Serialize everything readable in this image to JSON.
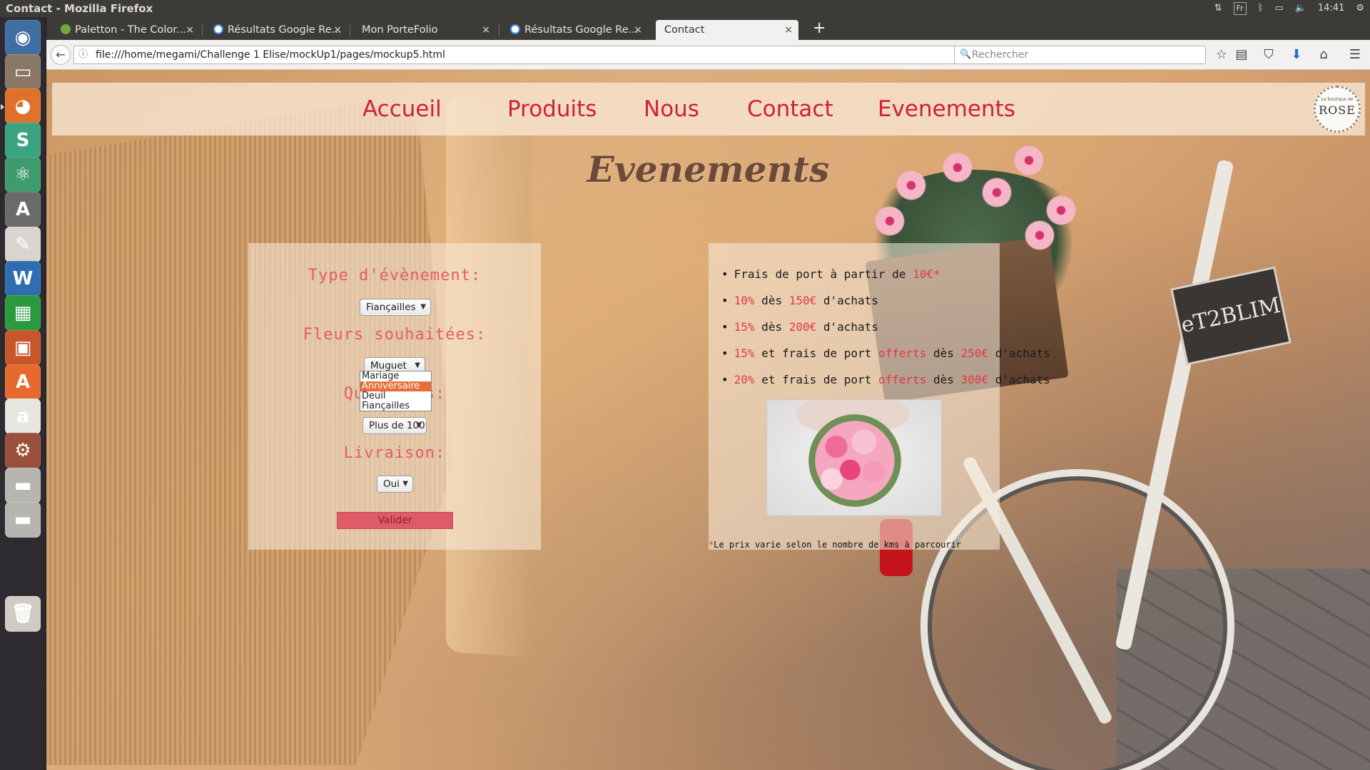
{
  "os": {
    "window_title": "Contact - Mozilla Firefox",
    "indicators": {
      "keyboard": "Fr",
      "time": "14:41"
    }
  },
  "launcher": {
    "items": [
      {
        "name": "ubuntu-dash-icon",
        "color": "#3f6ea3",
        "glyph": "◉"
      },
      {
        "name": "files-icon",
        "color": "#8a7765",
        "glyph": "▭"
      },
      {
        "name": "firefox-icon",
        "color": "#e0712a",
        "glyph": "◕"
      },
      {
        "name": "slack-icon",
        "color": "#3aa37f",
        "glyph": "S"
      },
      {
        "name": "atom-icon",
        "color": "#3e9b6e",
        "glyph": "⚛"
      },
      {
        "name": "software-updater-icon",
        "color": "#6a6a6a",
        "glyph": "A"
      },
      {
        "name": "text-editor-icon",
        "color": "#d8d5cf",
        "glyph": "✎"
      },
      {
        "name": "libreoffice-writer-icon",
        "color": "#2f6db3",
        "glyph": "W"
      },
      {
        "name": "libreoffice-calc-icon",
        "color": "#2b9a3f",
        "glyph": "▦"
      },
      {
        "name": "libreoffice-impress-icon",
        "color": "#c7562b",
        "glyph": "▣"
      },
      {
        "name": "ubuntu-software-icon",
        "color": "#e66a2c",
        "glyph": "A"
      },
      {
        "name": "amazon-icon",
        "color": "#e8e6e1",
        "glyph": "a"
      },
      {
        "name": "system-settings-icon",
        "color": "#9a4f3a",
        "glyph": "⚙"
      },
      {
        "name": "drive-icon",
        "color": "#b7b5b0",
        "glyph": "▬"
      },
      {
        "name": "drive-2-icon",
        "color": "#b7b5b0",
        "glyph": "▬"
      },
      {
        "name": "trash-icon",
        "color": "#cfccc6",
        "glyph": "🗑"
      }
    ]
  },
  "browser": {
    "tabs": [
      {
        "label": "Paletton - The Color...",
        "close": "×"
      },
      {
        "label": "Résultats Google Re...",
        "close": "×"
      },
      {
        "label": "Mon PorteFolio",
        "close": "×"
      },
      {
        "label": "Résultats Google Re...",
        "close": "×"
      },
      {
        "label": "Contact",
        "close": "×"
      }
    ],
    "new_tab": "+",
    "back": "←",
    "url": "file:///home/megami/Challenge 1 Elise/mockUp1/pages/mockup5.html",
    "search_placeholder": "Rechercher",
    "icons": {
      "info": "ⓘ",
      "reload": "↻",
      "search": "🔍",
      "bookmark": "☆",
      "reading_list": "▤",
      "pocket": "⛉",
      "download": "⬇",
      "home": "⌂",
      "menu": "☰"
    }
  },
  "site": {
    "nav": [
      "Accueil",
      "Produits",
      "Nous",
      "Contact",
      "Evenements"
    ],
    "logo": {
      "small": "La boutique de",
      "word": "ROSE"
    },
    "title": "Evenements",
    "form": {
      "event_type_label": "Type d'évènement:",
      "event_type_value": "Fiançailles",
      "event_type_options": [
        "Mariage",
        "Anniversaire",
        "Deuil",
        "Fiançailles"
      ],
      "highlighted_option": "Anniversaire",
      "flowers_label": "Fleurs souhaitées:",
      "flowers_value": "Muguet",
      "quantity_label": "Quantités:",
      "quantity_value": "Plus de 100",
      "delivery_label": "Livraison:",
      "delivery_value": "Oui",
      "submit": "Valider"
    },
    "pricing": {
      "items": [
        {
          "a": "Frais de port à partir de ",
          "b": "10€*",
          "c": "",
          "d": "",
          "e": ""
        },
        {
          "a": "",
          "b": "10%",
          "c": " dès ",
          "d": "150€",
          "e": " d'achats"
        },
        {
          "a": "",
          "b": "15%",
          "c": " dès ",
          "d": "200€",
          "e": " d'achats"
        },
        {
          "a": "",
          "b": "15%",
          "c": " et frais de port ",
          "d": "offerts",
          "e": " dès ",
          "f": "250€",
          "g": " d'achats"
        },
        {
          "a": "",
          "b": "20%",
          "c": " et frais de port ",
          "d": "offerts",
          "e": " dès ",
          "f": "300€",
          "g": " d'achats"
        }
      ],
      "note_star": "*",
      "note": "Le prix varie selon le nombre de kms à parcourir"
    },
    "colors": {
      "accent": "#cf1f3f",
      "label": "#e25d67",
      "highlight": "#e23a45",
      "title": "#6b4a3a"
    }
  }
}
